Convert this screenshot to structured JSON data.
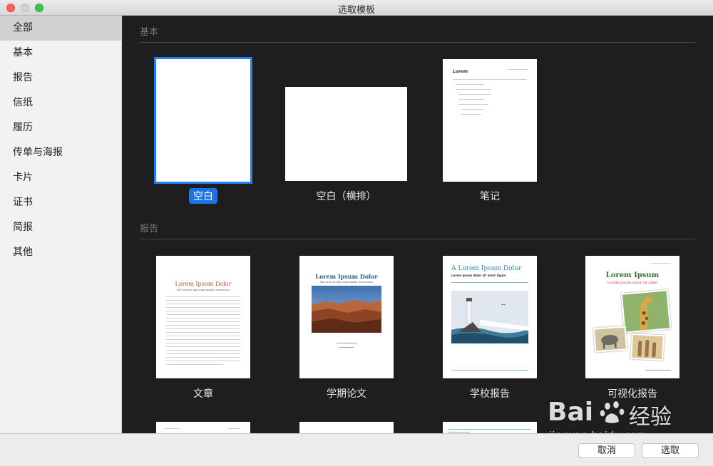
{
  "window": {
    "title": "选取模板"
  },
  "sidebar": {
    "items": [
      {
        "label": "全部"
      },
      {
        "label": "基本"
      },
      {
        "label": "报告"
      },
      {
        "label": "信纸"
      },
      {
        "label": "履历"
      },
      {
        "label": "传单与海报"
      },
      {
        "label": "卡片"
      },
      {
        "label": "证书"
      },
      {
        "label": "简报"
      },
      {
        "label": "其他"
      }
    ],
    "selected_index": 0
  },
  "sections": {
    "basic": {
      "header": "基本",
      "templates": [
        {
          "caption": "空白"
        },
        {
          "caption": "空白（横排）"
        },
        {
          "caption": "笔记"
        }
      ]
    },
    "report": {
      "header": "报告",
      "templates": [
        {
          "caption": "文章",
          "title": "Lorem Ipsum Dolor",
          "subtitle": "Sed ut lacus quis nunc mattis consectetur"
        },
        {
          "caption": "学期论文",
          "title": "Lorem Ipsum Dolor",
          "subtitle": "Sed ut lacus quis nunc mattis consectetur"
        },
        {
          "caption": "学校报告",
          "title": "A Lorem Ipsum Dolor",
          "subtitle": "Lorem ipsum dolor sit amet ligula"
        },
        {
          "caption": "可视化报告",
          "title": "Lorem Ipsum",
          "subtitle": "Lorem ipsum dolor sit amet"
        }
      ]
    }
  },
  "note_thumb": {
    "title": "Lorem"
  },
  "footer": {
    "cancel_label": "取消",
    "choose_label": "选取"
  },
  "watermark": {
    "brand": "Bai",
    "brand2": "经验",
    "url": "jingyan.baidu.com"
  },
  "colors": {
    "accent": "#1a74e3",
    "report_title": "#c2553a",
    "term_title": "#2f5d99",
    "school_title": "#2d8ea0",
    "visual_title": "#3b6e2e"
  }
}
